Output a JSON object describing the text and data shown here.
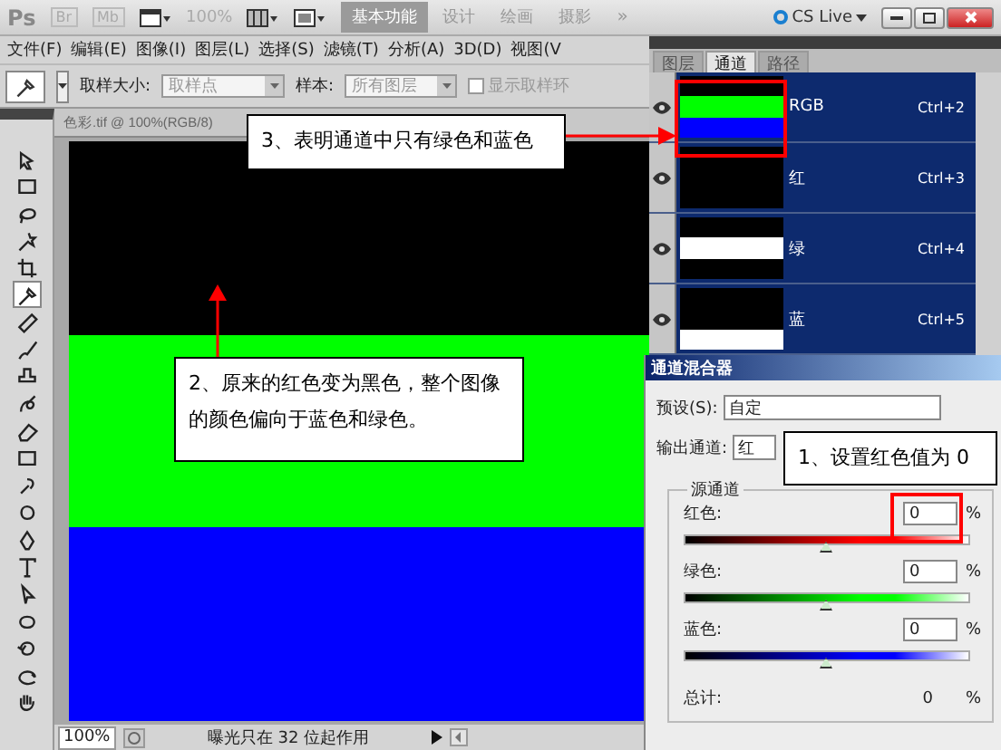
{
  "app_bar": {
    "logo": "Ps",
    "bridge": "Br",
    "mini_bridge": "Mb",
    "zoom": "100%",
    "workspaces": [
      {
        "label": "基本功能",
        "selected": true
      },
      {
        "label": "设计",
        "selected": false
      },
      {
        "label": "绘画",
        "selected": false
      },
      {
        "label": "摄影",
        "selected": false
      }
    ],
    "more": "»",
    "cs_live": "CS Live"
  },
  "menu": [
    "文件(F)",
    "编辑(E)",
    "图像(I)",
    "图层(L)",
    "选择(S)",
    "滤镜(T)",
    "分析(A)",
    "3D(D)",
    "视图(V"
  ],
  "options_bar": {
    "sample_size_label": "取样大小:",
    "sample_size": "取样点",
    "sample_label": "样本:",
    "sample": "所有图层",
    "show_ring": {
      "label": "显示取样环",
      "checked": false
    }
  },
  "tools": [
    {
      "selected": false
    },
    {
      "selected": false
    },
    {
      "selected": false
    },
    {
      "selected": false
    },
    {
      "selected": false
    },
    {
      "selected": true
    },
    {
      "selected": false
    },
    {
      "selected": false
    },
    {
      "selected": false
    },
    {
      "selected": false
    },
    {
      "selected": false
    },
    {
      "selected": false
    },
    {
      "selected": false
    },
    {
      "selected": false
    },
    {
      "selected": false
    },
    {
      "selected": false
    },
    {
      "selected": false
    },
    {
      "selected": false
    },
    {
      "selected": false
    },
    {
      "selected": false
    },
    {
      "selected": false
    }
  ],
  "document": {
    "title": "色彩.tif @ 100%(RGB/8)",
    "bands": [
      {
        "color": "#000000"
      },
      {
        "color": "#00ff00"
      },
      {
        "color": "#0000ff"
      }
    ]
  },
  "status_bar": {
    "zoom": "100%",
    "info": "曝光只在 32 位起作用"
  },
  "channels_panel": {
    "tabs": [
      {
        "label": "图层",
        "selected": false
      },
      {
        "label": "通道",
        "selected": true
      },
      {
        "label": "路径",
        "selected": false
      }
    ],
    "channels": [
      {
        "name": "RGB",
        "shortcut": "Ctrl+2",
        "visible": true,
        "thumbnail": [
          {
            "color": "#000000"
          },
          {
            "color": "#00ff00"
          },
          {
            "color": "#0000ff"
          }
        ]
      },
      {
        "name": "红",
        "shortcut": "Ctrl+3",
        "visible": true,
        "thumbnail": [
          {
            "color": "#000000"
          },
          {
            "color": "#000000"
          },
          {
            "color": "#000000"
          }
        ]
      },
      {
        "name": "绿",
        "shortcut": "Ctrl+4",
        "visible": true,
        "thumbnail": [
          {
            "color": "#000000"
          },
          {
            "color": "#ffffff"
          },
          {
            "color": "#000000"
          }
        ]
      },
      {
        "name": "蓝",
        "shortcut": "Ctrl+5",
        "visible": true,
        "thumbnail": [
          {
            "color": "#000000"
          },
          {
            "color": "#000000"
          },
          {
            "color": "#ffffff"
          }
        ]
      }
    ]
  },
  "channel_mixer": {
    "title": "通道混合器",
    "preset_label": "预设(S):",
    "preset": "自定",
    "output_label": "输出通道:",
    "output": "红",
    "group_label": "源通道",
    "sources": [
      {
        "label": "红色:",
        "value": "0",
        "unit": "%",
        "color": "#ff0000",
        "level": 0.5
      },
      {
        "label": "绿色:",
        "value": "0",
        "unit": "%",
        "color": "#00ff00",
        "level": 0.5
      },
      {
        "label": "蓝色:",
        "value": "0",
        "unit": "%",
        "color": "#0000ff",
        "level": 0.5
      }
    ],
    "total_label": "总计:",
    "total": "0",
    "total_unit": "%"
  },
  "callouts": [
    {
      "text": "3、表明通道中只有绿色和蓝色"
    },
    {
      "text": "2、原来的红色变为黑色，整个图像的颜色偏向于蓝色和绿色。"
    },
    {
      "text": "1、设置红色值为 0"
    }
  ]
}
